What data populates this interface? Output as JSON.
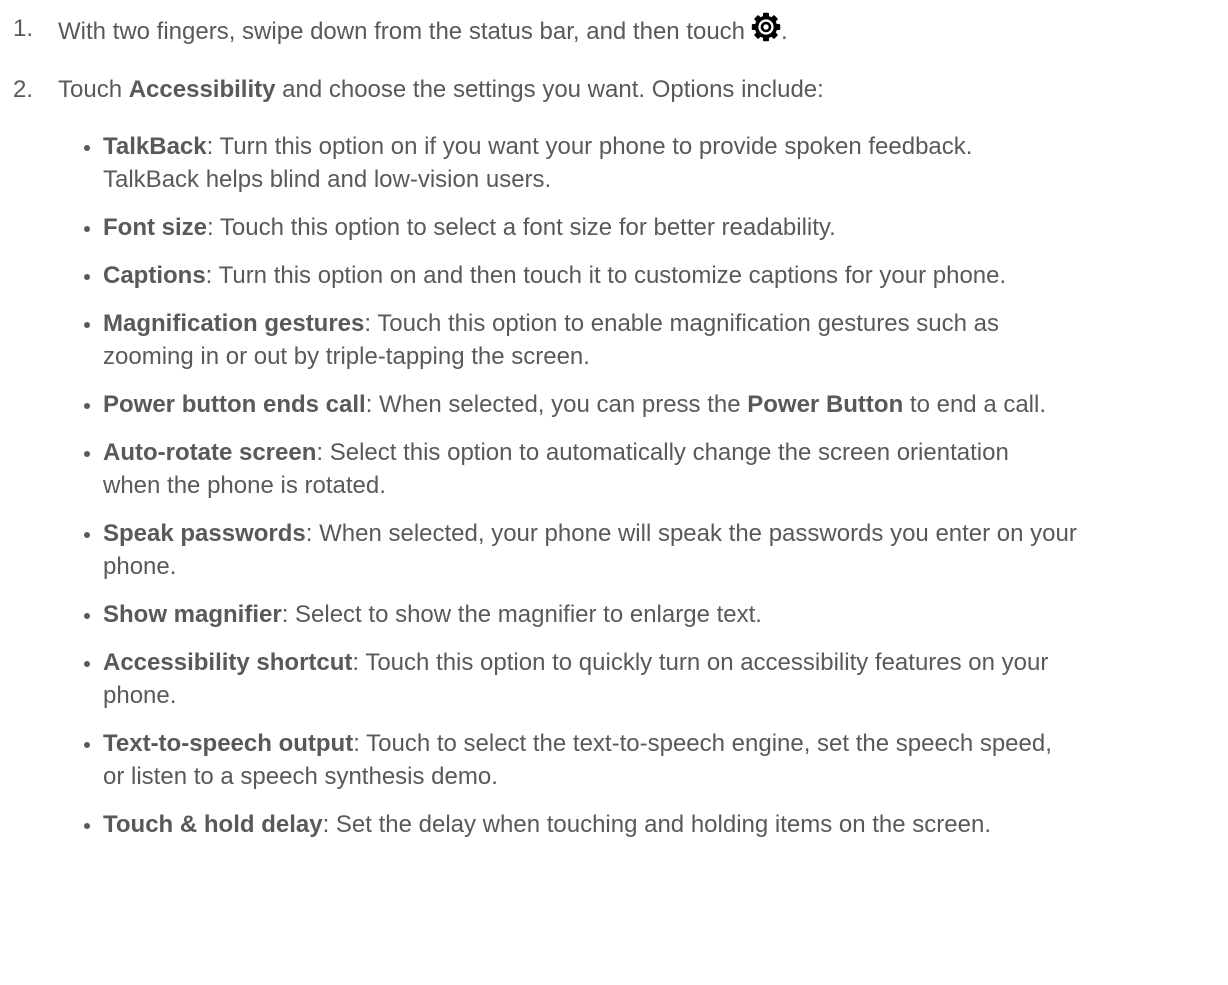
{
  "step1": {
    "number": "1.",
    "text": "With two fingers, swipe down from the status bar, and then touch",
    "icon": "settings-gear-icon",
    "end": "."
  },
  "step2": {
    "number": "2.",
    "before": "Touch ",
    "bold": "Accessibility",
    "after": " and choose the settings you want. Options include:"
  },
  "options": [
    {
      "name": "TalkBack",
      "lines": [
        ": Turn this option on if you want your phone to provide spoken feedback.",
        "TalkBack helps blind and low-vision users."
      ]
    },
    {
      "name": "Font size",
      "lines": [
        ": Touch this option to select a font size for better readability."
      ]
    },
    {
      "name": "Captions",
      "lines": [
        ": Turn this option on and then touch it to customize captions for your phone."
      ]
    },
    {
      "name": "Magnification gestures",
      "lines": [
        ": Touch this option to enable magnification gestures such as",
        "zooming in or out by triple-tapping the screen."
      ]
    },
    {
      "name": "Power button ends call",
      "before": ": When selected, you can press the ",
      "bold": "Power Button",
      "after": " to end a call."
    },
    {
      "name": "Auto-rotate screen",
      "lines": [
        ": Select this option to automatically change the screen orientation",
        "when the phone is rotated."
      ]
    },
    {
      "name": "Speak passwords",
      "lines": [
        ": When selected, your phone will speak the passwords you enter on your",
        "phone."
      ]
    },
    {
      "name": "Show magnifier",
      "lines": [
        ": Select to show the magnifier to enlarge text."
      ]
    },
    {
      "name": "Accessibility shortcut",
      "lines": [
        ": Touch this option to quickly turn on accessibility features on your",
        "phone."
      ]
    },
    {
      "name": "Text-to-speech output",
      "lines": [
        ": Touch to select the text-to-speech engine, set the speech speed,",
        "or listen to a speech synthesis demo."
      ]
    },
    {
      "name": "Touch & hold delay",
      "lines": [
        ": Set the delay when touching and holding items on the screen."
      ]
    }
  ]
}
